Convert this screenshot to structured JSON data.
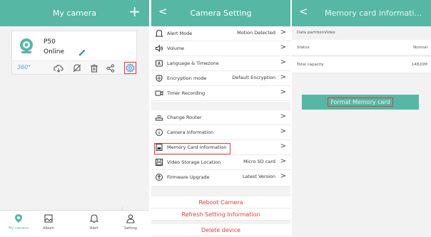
{
  "home": {
    "title": "My camera",
    "add_icon": "+",
    "camera": {
      "name": "P50",
      "status": "Online"
    },
    "toolbar_360": "360°",
    "tabs": [
      {
        "label": "My camera",
        "icon": "location-pin-icon"
      },
      {
        "label": "Album",
        "icon": "album-icon"
      },
      {
        "label": "Alert",
        "icon": "bell-icon"
      },
      {
        "label": "Setting",
        "icon": "user-icon"
      }
    ]
  },
  "settings": {
    "title": "Camera Setting",
    "back": "<",
    "rows": [
      {
        "label": "Alert Mode",
        "value": "Motion Detected",
        "icon": "bell-icon"
      },
      {
        "label": "Volume",
        "value": "",
        "icon": "speaker-icon"
      },
      {
        "label": "Language & Timezone",
        "value": "",
        "icon": "language-icon"
      },
      {
        "label": "Encryption mode",
        "value": "Default Encryption",
        "icon": "shield-icon"
      },
      {
        "label": "Timer Recording",
        "value": "",
        "icon": "video-icon"
      },
      {
        "label": "Change Router",
        "value": "",
        "icon": "router-icon"
      },
      {
        "label": "Camera Information",
        "value": "",
        "icon": "info-icon"
      },
      {
        "label": "Memory Card Information",
        "value": "",
        "icon": "memory-card-icon"
      },
      {
        "label": "Video Storage Location",
        "value": "Micro SD card",
        "icon": "save-icon"
      },
      {
        "label": "Firmware Upgrade",
        "value": "Latest Version",
        "icon": "upgrade-icon"
      }
    ],
    "actions": [
      "Reboot Camera",
      "Refresh Setting Information",
      "Delete device"
    ],
    "chevron": ">"
  },
  "memory": {
    "title": "Memory card informati...",
    "back": "<",
    "section": "Data partitionVideo",
    "rows": [
      {
        "label": "Status",
        "value": "Normal"
      },
      {
        "label": "Total capacity",
        "value": "14820M"
      }
    ],
    "format_button": "Format Memory card"
  },
  "colors": {
    "accent": "#56b7a4",
    "danger": "#e23b3b",
    "highlight": "#e63a3a"
  }
}
